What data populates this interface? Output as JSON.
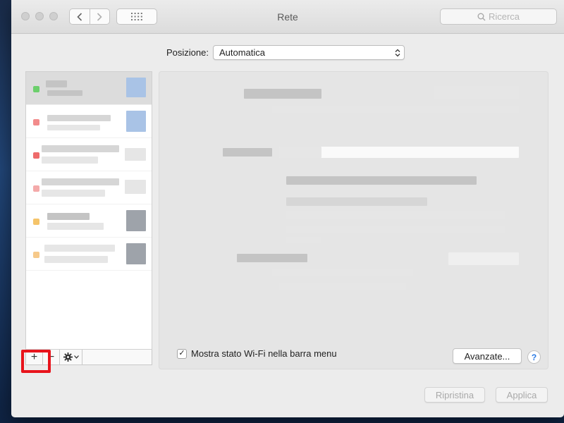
{
  "window": {
    "title": "Rete",
    "search_placeholder": "Ricerca"
  },
  "location": {
    "label": "Posizione:",
    "selected": "Automatica"
  },
  "sidebar": {
    "services": [
      {
        "status_color": "#6ccf6c"
      },
      {
        "status_color": "#f28b8b"
      },
      {
        "status_color": "#ee6b6b"
      },
      {
        "status_color": "#f4aaaa"
      },
      {
        "status_color": "#f5c46a"
      },
      {
        "status_color": "#f6c98a"
      }
    ],
    "toolbar": {
      "add_label": "+",
      "remove_label": "−"
    }
  },
  "main": {
    "show_wifi_status_label": "Mostra stato Wi-Fi nella barra menu",
    "show_wifi_status_checked": true,
    "checkmark": "✓",
    "advanced_button": "Avanzate...",
    "help_label": "?"
  },
  "footer": {
    "revert_button": "Ripristina",
    "apply_button": "Applica"
  },
  "colors": {
    "highlight": "#e8141c",
    "accent": "#2a7ae4"
  }
}
